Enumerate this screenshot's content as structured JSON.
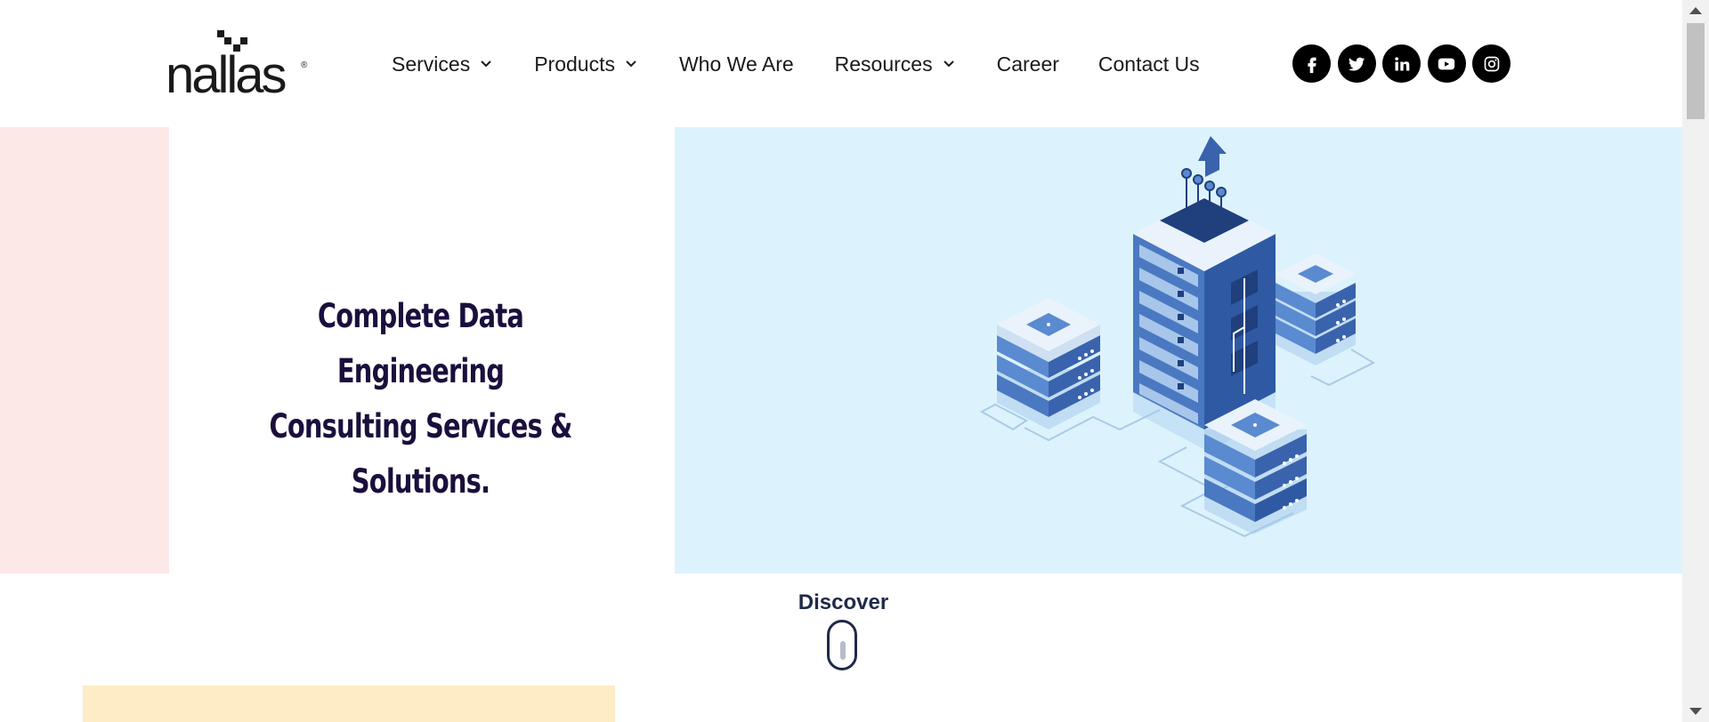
{
  "brand": {
    "logo_text": "nallas",
    "logo_mark": "®"
  },
  "nav": {
    "items": [
      {
        "label": "Services",
        "has_dropdown": true
      },
      {
        "label": "Products",
        "has_dropdown": true
      },
      {
        "label": "Who We Are",
        "has_dropdown": false
      },
      {
        "label": "Resources",
        "has_dropdown": true
      },
      {
        "label": "Career",
        "has_dropdown": false
      },
      {
        "label": "Contact Us",
        "has_dropdown": false
      }
    ]
  },
  "social": [
    {
      "name": "facebook-icon"
    },
    {
      "name": "twitter-icon"
    },
    {
      "name": "linkedin-icon"
    },
    {
      "name": "youtube-icon"
    },
    {
      "name": "instagram-icon"
    }
  ],
  "hero": {
    "title_line1": "Complete Data Engineering",
    "title_line2": "Consulting Services & Solutions.",
    "illustration": "data-servers-illustration"
  },
  "discover": {
    "label": "Discover",
    "icon": "scroll-mouse-icon"
  },
  "colors": {
    "hero_pink": "#fde8e8",
    "hero_blue": "#dcf3fd",
    "title": "#1b0f3d",
    "peach": "#fdecc6",
    "social_bg": "#000000"
  }
}
